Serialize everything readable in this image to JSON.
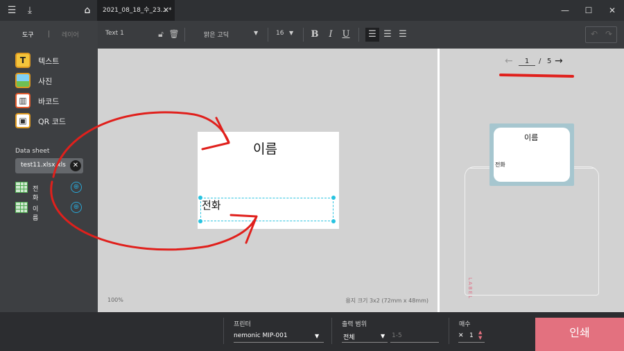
{
  "titlebar": {
    "doc_tab_title": "2021_08_18_수_23... *",
    "close_glyph": "✕",
    "icons": [
      "hamburger-menu-icon",
      "download-icon",
      "home-icon"
    ],
    "window_controls": [
      "minimize-icon",
      "maximize-icon",
      "close-icon"
    ]
  },
  "sidebar": {
    "tab_tools": "도구",
    "tab_layers": "레이어",
    "tools": [
      {
        "label": "텍스트",
        "icon": "text-tool-icon",
        "glyph": "T"
      },
      {
        "label": "사진",
        "icon": "image-tool-icon",
        "glyph": "▦"
      },
      {
        "label": "바코드",
        "icon": "barcode-tool-icon",
        "glyph": "▥"
      },
      {
        "label": "QR 코드",
        "icon": "qr-code-tool-icon",
        "glyph": "▣"
      }
    ],
    "data_sheet_title": "Data sheet",
    "data_file": "test11.xlsx.xls",
    "columns": [
      {
        "label": "전화"
      },
      {
        "label": "이름"
      }
    ]
  },
  "toolbar": {
    "object_name": "Text 1",
    "font_family": "맑은 고딕",
    "font_size": "16",
    "format_buttons": [
      "bold-icon",
      "italic-icon",
      "underline-icon",
      "align-left-icon",
      "align-center-icon",
      "align-right-icon"
    ],
    "bold": "B",
    "italic": "I",
    "underline": "U"
  },
  "canvas": {
    "label_name_text": "이름",
    "label_phone_text": "전화",
    "zoom": "100%",
    "paper_size": "용지 크기 3x2 (72mm x 48mm)"
  },
  "preview": {
    "page_current": "1",
    "page_separator": "/",
    "page_total": "5",
    "label_name_text": "이름",
    "label_phone_text": "전화",
    "brand_text": "LABEL"
  },
  "bottombar": {
    "printer_label": "프린터",
    "printer_value": "nemonic MIP-001",
    "range_label": "출력 범위",
    "range_value": "전체",
    "range_placeholder": "1-5",
    "copies_label": "매수",
    "copies_value": "1",
    "print_button": "인쇄"
  },
  "colors": {
    "annotation_red": "#e0201c",
    "accent_cyan": "#27c3e0",
    "print_button": "#e3717f"
  }
}
